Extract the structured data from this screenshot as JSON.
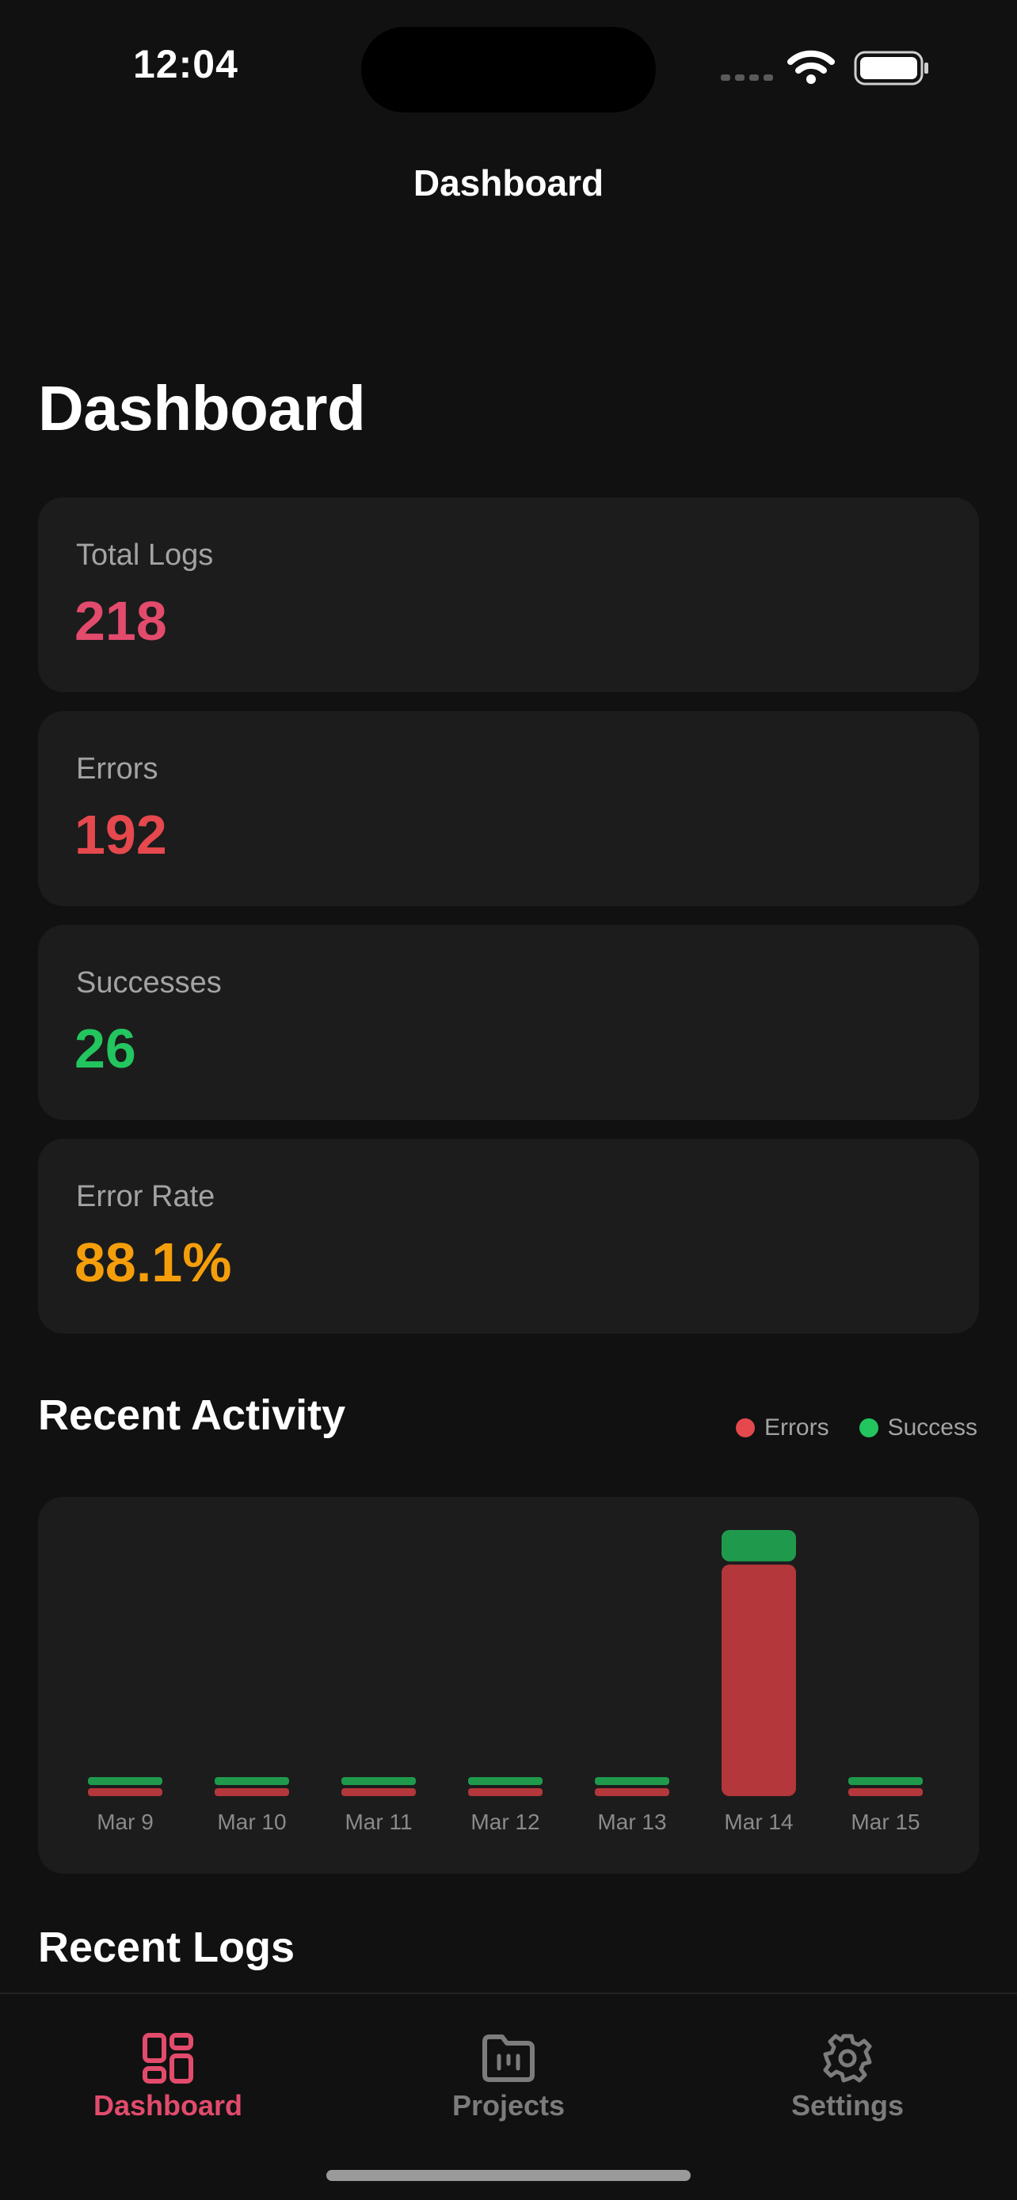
{
  "status": {
    "time": "12:04"
  },
  "nav": {
    "title": "Dashboard"
  },
  "page": {
    "title": "Dashboard"
  },
  "stats": [
    {
      "label": "Total Logs",
      "value": "218",
      "color": "#e24b6c"
    },
    {
      "label": "Errors",
      "value": "192",
      "color": "#e5484d"
    },
    {
      "label": "Successes",
      "value": "26",
      "color": "#22c55e"
    },
    {
      "label": "Error Rate",
      "value": "88.1%",
      "color": "#f59e0b"
    }
  ],
  "activity": {
    "title": "Recent Activity",
    "legend": {
      "errors": "Errors",
      "success": "Success"
    }
  },
  "chart_data": {
    "type": "bar",
    "stacked": true,
    "categories": [
      "Mar 9",
      "Mar 10",
      "Mar 11",
      "Mar 12",
      "Mar 13",
      "Mar 14",
      "Mar 15"
    ],
    "series": [
      {
        "name": "Errors",
        "color": "#b3373b",
        "values": [
          0,
          0,
          0,
          0,
          0,
          192,
          0
        ]
      },
      {
        "name": "Success",
        "color": "#1f9a4d",
        "values": [
          0,
          0,
          0,
          0,
          0,
          26,
          0
        ]
      }
    ],
    "legend_position": "top-right",
    "grid": false
  },
  "logs": {
    "title": "Recent Logs"
  },
  "tabs": [
    {
      "label": "Dashboard",
      "icon": "dashboard-grid-icon",
      "active": true
    },
    {
      "label": "Projects",
      "icon": "folder-icon",
      "active": false
    },
    {
      "label": "Settings",
      "icon": "gear-icon",
      "active": false
    }
  ]
}
